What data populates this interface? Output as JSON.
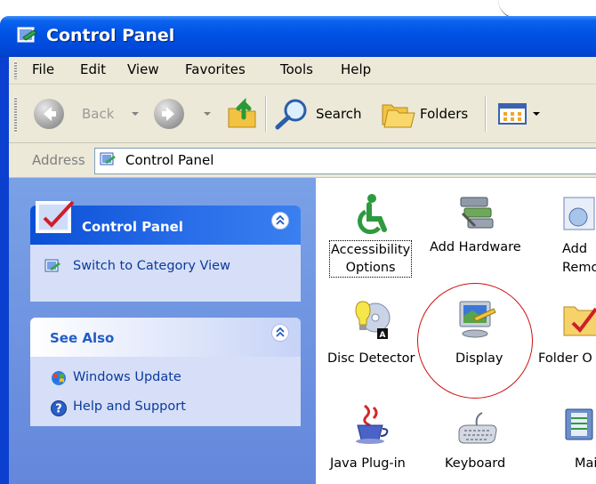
{
  "window": {
    "title": "Control Panel"
  },
  "menu": [
    "File",
    "Edit",
    "View",
    "Favorites",
    "Tools",
    "Help"
  ],
  "toolbar": {
    "back": "Back",
    "search": "Search",
    "folders": "Folders"
  },
  "address": {
    "label": "Address",
    "value": "Control Panel"
  },
  "left_pane": {
    "control_panel_box": {
      "title": "Control Panel",
      "task": "Switch to Category View"
    },
    "see_also_box": {
      "title": "See Also",
      "links": [
        "Windows Update",
        "Help and Support"
      ]
    }
  },
  "items": {
    "accessibility": [
      "Accessibility",
      "Options"
    ],
    "add_hardware": "Add Hardware",
    "add_remove": [
      "Add",
      "Remov"
    ],
    "disc_detector": "Disc Detector",
    "display": "Display",
    "folder_options": "Folder O",
    "java": "Java Plug-in",
    "keyboard": "Keyboard",
    "mail": "Mai"
  },
  "colors": {
    "title_blue": "#0052e3",
    "pane_blue": "#6e94e0",
    "link_blue": "#0c3a9b",
    "highlight_circle": "#d01010"
  }
}
